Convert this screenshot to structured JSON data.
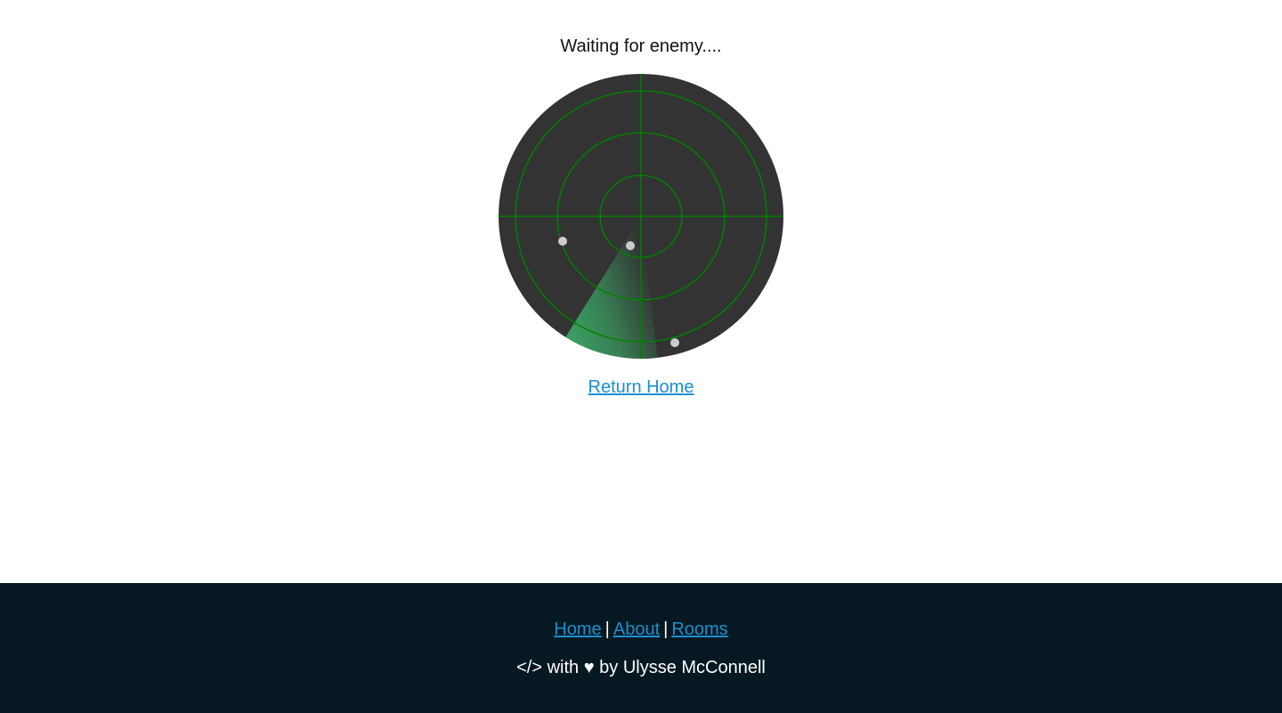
{
  "main": {
    "status_text": "Waiting for enemy....",
    "return_link": "Return Home"
  },
  "radar": {
    "background_color": "#333333",
    "line_color": "#008000",
    "sweep_color": "#3bb36a",
    "blip_color": "#cccccc",
    "icon": "radar-scope"
  },
  "footer": {
    "nav": {
      "home": "Home",
      "separator_1": "|",
      "about": "About",
      "separator_2": "|",
      "rooms": "Rooms"
    },
    "credit": "</> with ♥ by Ulysse McConnell",
    "background_color": "#061922",
    "link_color": "#1a8fd0"
  }
}
